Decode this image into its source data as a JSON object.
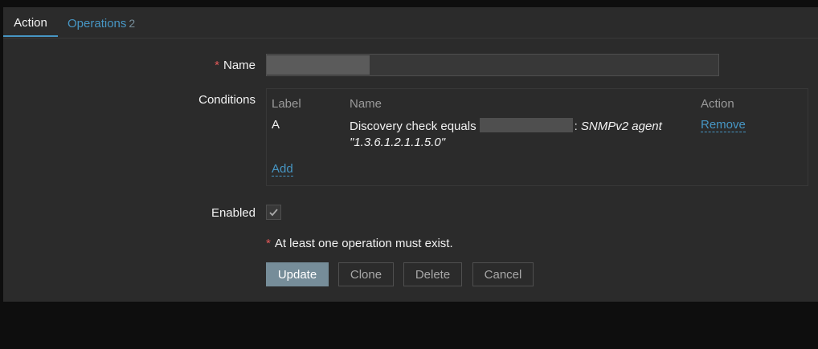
{
  "tabs": {
    "action_label": "Action",
    "operations_label": "Operations",
    "operations_count": "2"
  },
  "form": {
    "name_required_marker": "*",
    "name_label": "Name",
    "name_value": "",
    "conditions_label": "Conditions",
    "enabled_label": "Enabled",
    "enabled_checked": true
  },
  "conditions": {
    "headers": {
      "label": "Label",
      "name": "Name",
      "action": "Action"
    },
    "rows": [
      {
        "label": "A",
        "name_prefix": "Discovery check equals",
        "name_sep": ":",
        "name_italic_line1": "SNMPv2 agent",
        "name_italic_line2": "\"1.3.6.1.2.1.1.5.0\"",
        "action_label": "Remove"
      }
    ],
    "add_label": "Add"
  },
  "warning": {
    "marker": "*",
    "text": "At least one operation must exist."
  },
  "buttons": {
    "update": "Update",
    "clone": "Clone",
    "delete": "Delete",
    "cancel": "Cancel"
  },
  "colors": {
    "panel_bg": "#2b2b2b",
    "page_bg": "#0e0e0e",
    "link": "#4796c4",
    "required": "#e45959",
    "primary_button": "#768d99"
  }
}
